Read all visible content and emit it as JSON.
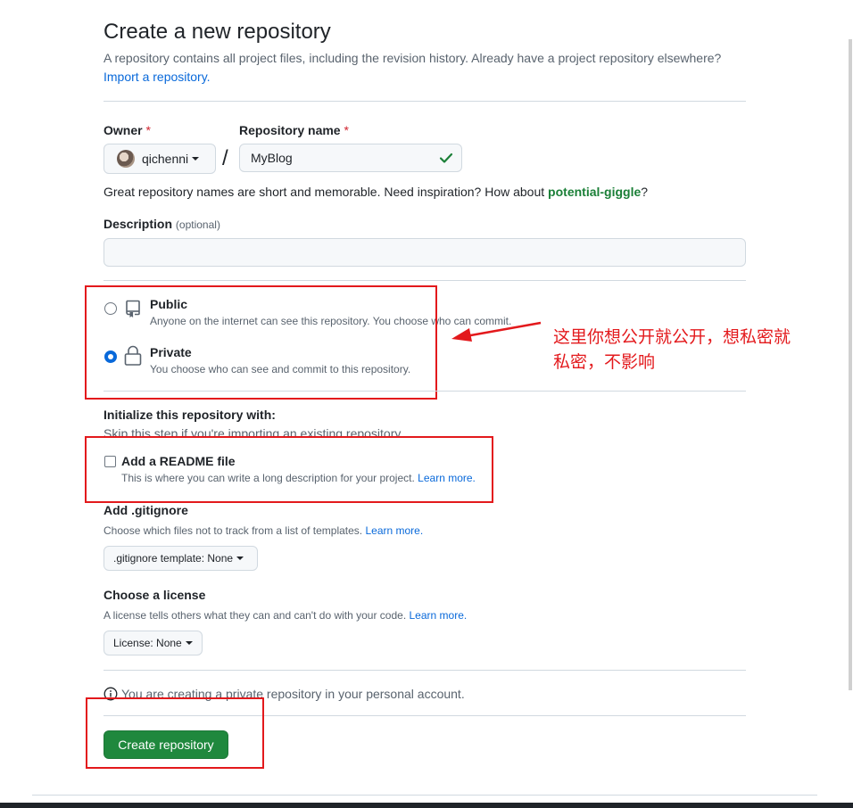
{
  "header": {
    "title": "Create a new repository",
    "subtitle": "A repository contains all project files, including the revision history. Already have a project repository elsewhere?",
    "import_link": "Import a repository."
  },
  "owner": {
    "label": "Owner",
    "required_mark": "*",
    "value": "qichenni"
  },
  "separator": "/",
  "repo_name": {
    "label": "Repository name",
    "required_mark": "*",
    "value": "MyBlog"
  },
  "name_hint": {
    "text": "Great repository names are short and memorable. Need inspiration? How about ",
    "suggestion": "potential-giggle",
    "end": "?"
  },
  "description": {
    "label": "Description",
    "optional": "(optional)",
    "value": ""
  },
  "visibility": {
    "public": {
      "label": "Public",
      "desc": "Anyone on the internet can see this repository. You choose who can commit.",
      "checked": false
    },
    "private": {
      "label": "Private",
      "desc": "You choose who can see and commit to this repository.",
      "checked": true
    }
  },
  "annotation": "这里你想公开就公开，想私密就\n私密，不影响",
  "initialize": {
    "title": "Initialize this repository with:",
    "skip": "Skip this step if you're importing an existing repository."
  },
  "readme": {
    "label": "Add a README file",
    "desc": "This is where you can write a long description for your project.",
    "learn_more": "Learn more.",
    "checked": false
  },
  "gitignore": {
    "title": "Add .gitignore",
    "desc": "Choose which files not to track from a list of templates.",
    "learn_more": "Learn more.",
    "button": ".gitignore template: None"
  },
  "license": {
    "title": "Choose a license",
    "desc": "A license tells others what they can and can't do with your code.",
    "learn_more": "Learn more.",
    "button": "License: None"
  },
  "notice": "You are creating a private repository in your personal account.",
  "create_button": "Create repository",
  "colors": {
    "annotation_red": "#e3191c",
    "primary_green": "#1f883d",
    "link_blue": "#0969da",
    "success_green": "#1a7f37"
  }
}
